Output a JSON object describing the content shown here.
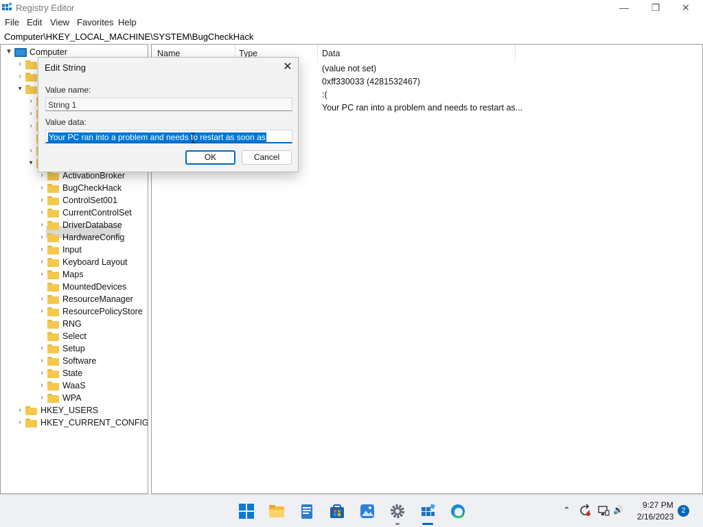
{
  "window": {
    "title": "Registry Editor",
    "minimize_glyph": "—",
    "maximize_glyph": "❐",
    "close_glyph": "✕"
  },
  "menu": [
    "File",
    "Edit",
    "View",
    "Favorites",
    "Help"
  ],
  "address": "Computer\\HKEY_LOCAL_MACHINE\\SYSTEM\\BugCheckHack",
  "tree": {
    "root": "Computer",
    "system_children": [
      "ActivationBroker",
      "BugCheckHack",
      "ControlSet001",
      "CurrentControlSet",
      "DriverDatabase",
      "HardwareConfig",
      "Input",
      "Keyboard Layout",
      "Maps",
      "MountedDevices",
      "ResourceManager",
      "ResourcePolicyStore",
      "RNG",
      "Select",
      "Setup",
      "Software",
      "State",
      "WaaS",
      "WPA"
    ],
    "bottom_hives": [
      "HKEY_USERS",
      "HKEY_CURRENT_CONFIG"
    ],
    "selected": "BugCheckHack"
  },
  "list": {
    "columns": [
      "Name",
      "Type",
      "Data"
    ],
    "rows": [
      {
        "data": "(value not set)"
      },
      {
        "data": "0xff330033 (4281532467)"
      },
      {
        "data": ":("
      },
      {
        "data": "Your PC  ran into a problem and needs to restart as..."
      }
    ]
  },
  "dialog": {
    "title": "Edit String",
    "close_glyph": "✕",
    "value_name_label": "Value name:",
    "value_name": "String 1",
    "value_data_label": "Value data:",
    "value_data": "Your PC  ran into a problem and needs to restart as soon as",
    "ok": "OK",
    "cancel": "Cancel"
  },
  "taskbar": {
    "time": "9:27 PM",
    "date": "2/16/2023",
    "notifications": "2",
    "chevron_glyph": "⌃",
    "volume_glyph": "🔊"
  },
  "colors": {
    "accent": "#0067c0",
    "folder": "#f5c84c",
    "selection": "#0078d7"
  }
}
